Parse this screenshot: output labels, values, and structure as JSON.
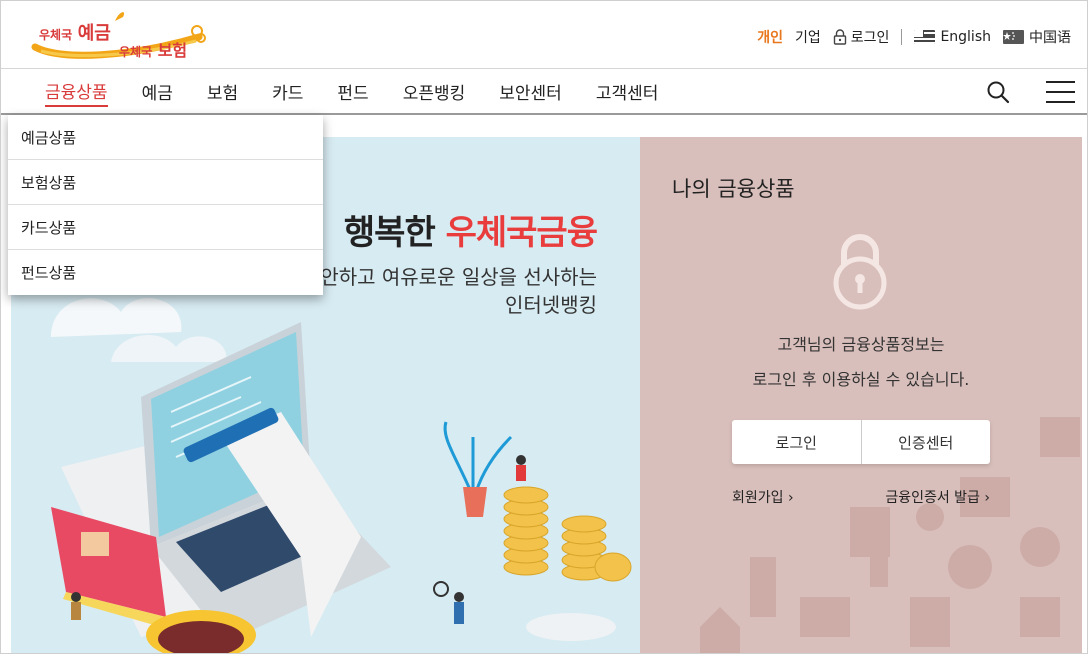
{
  "logo": {
    "line1_prefix": "우체국",
    "line1_word": "예금",
    "line2_prefix": "우체국",
    "line2_word": "보험"
  },
  "util": {
    "personal": "개인",
    "corporate": "기업",
    "login": "로그인",
    "english": "English",
    "chinese": "中国语"
  },
  "gnb": {
    "items": [
      "금융상품",
      "예금",
      "보험",
      "카드",
      "펀드",
      "오픈뱅킹",
      "보안센터",
      "고객센터"
    ]
  },
  "dropdown": {
    "items": [
      "예금상품",
      "보험상품",
      "카드상품",
      "펀드상품"
    ]
  },
  "banner": {
    "headline_prefix": "행복한",
    "headline_highlight": "우체국금융",
    "sub1": "안하고 여유로운 일상을 선사하는",
    "sub2": "인터넷뱅킹"
  },
  "panel": {
    "title": "나의 금융상품",
    "msg1": "고객님의 금융상품정보는",
    "msg2": "로그인 후 이용하실 수 있습니다.",
    "login_button": "로그인",
    "cert_button": "인증센터",
    "signup_link": "회원가입",
    "cert_issue_link": "금융인증서 발급"
  },
  "colors": {
    "accent_orange": "#e8771d",
    "accent_red": "#e93d3d",
    "banner_bg": "#d7ebf2",
    "panel_bg": "#d9bfbb"
  }
}
